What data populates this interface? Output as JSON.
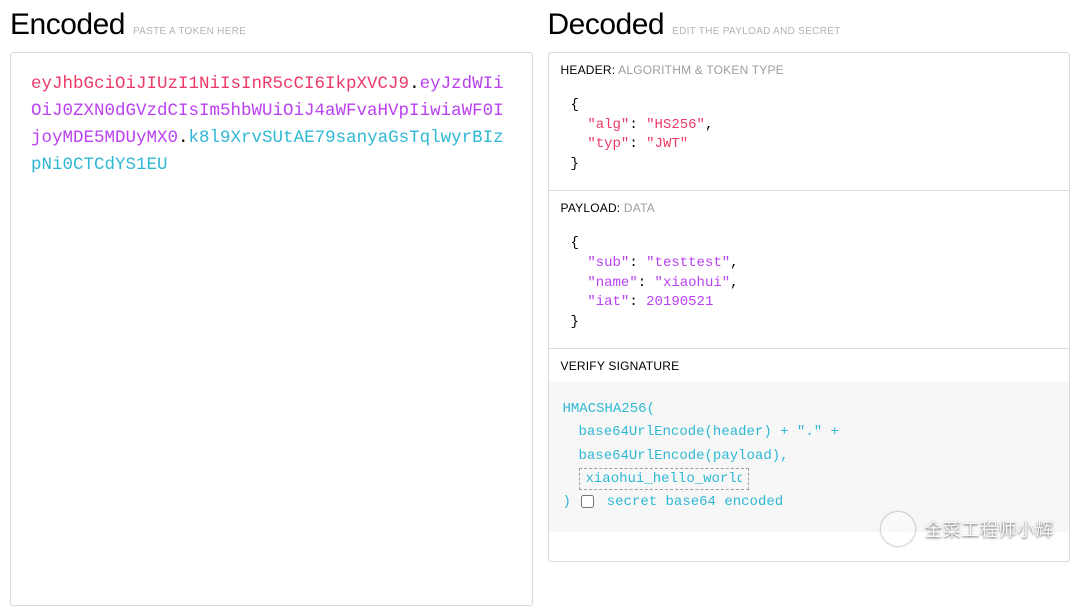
{
  "encoded": {
    "title": "Encoded",
    "subtitle": "PASTE A TOKEN HERE",
    "token_header": "eyJhbGciOiJIUzI1NiIsInR5cCI6IkpXVCJ9",
    "token_payload": "eyJzdWIiOiJ0ZXN0dGVzdCIsIm5hbWUiOiJ4aWFvaHVpIiwiaWF0IjoyMDE5MDUyMX0",
    "token_signature": "k8l9XrvSUtAE79sanyaGsTqlwyrBIzpNi0CTCdYS1EU",
    "dot": "."
  },
  "decoded": {
    "title": "Decoded",
    "subtitle": "EDIT THE PAYLOAD AND SECRET",
    "header_section": {
      "label": "HEADER:",
      "label_grey": "ALGORITHM & TOKEN TYPE",
      "alg_key": "\"alg\"",
      "alg_val": "\"HS256\"",
      "typ_key": "\"typ\"",
      "typ_val": "\"JWT\"",
      "brace_open": "{",
      "brace_close": "}",
      "colon": ": ",
      "comma": ","
    },
    "payload_section": {
      "label": "PAYLOAD:",
      "label_grey": "DATA",
      "sub_key": "\"sub\"",
      "sub_val": "\"testtest\"",
      "name_key": "\"name\"",
      "name_val": "\"xiaohui\"",
      "iat_key": "\"iat\"",
      "iat_val": "20190521",
      "brace_open": "{",
      "brace_close": "}",
      "colon": ": ",
      "comma": ","
    },
    "verify_section": {
      "label": "VERIFY SIGNATURE",
      "fn": "HMACSHA256(",
      "line1": "base64UrlEncode(header) + \".\" +",
      "line2": "base64UrlEncode(payload),",
      "secret_value": "xiaohui_hello_world",
      "close_paren": ")",
      "chk_label": "secret base64 encoded"
    }
  },
  "watermark": "全菜工程师小辉"
}
